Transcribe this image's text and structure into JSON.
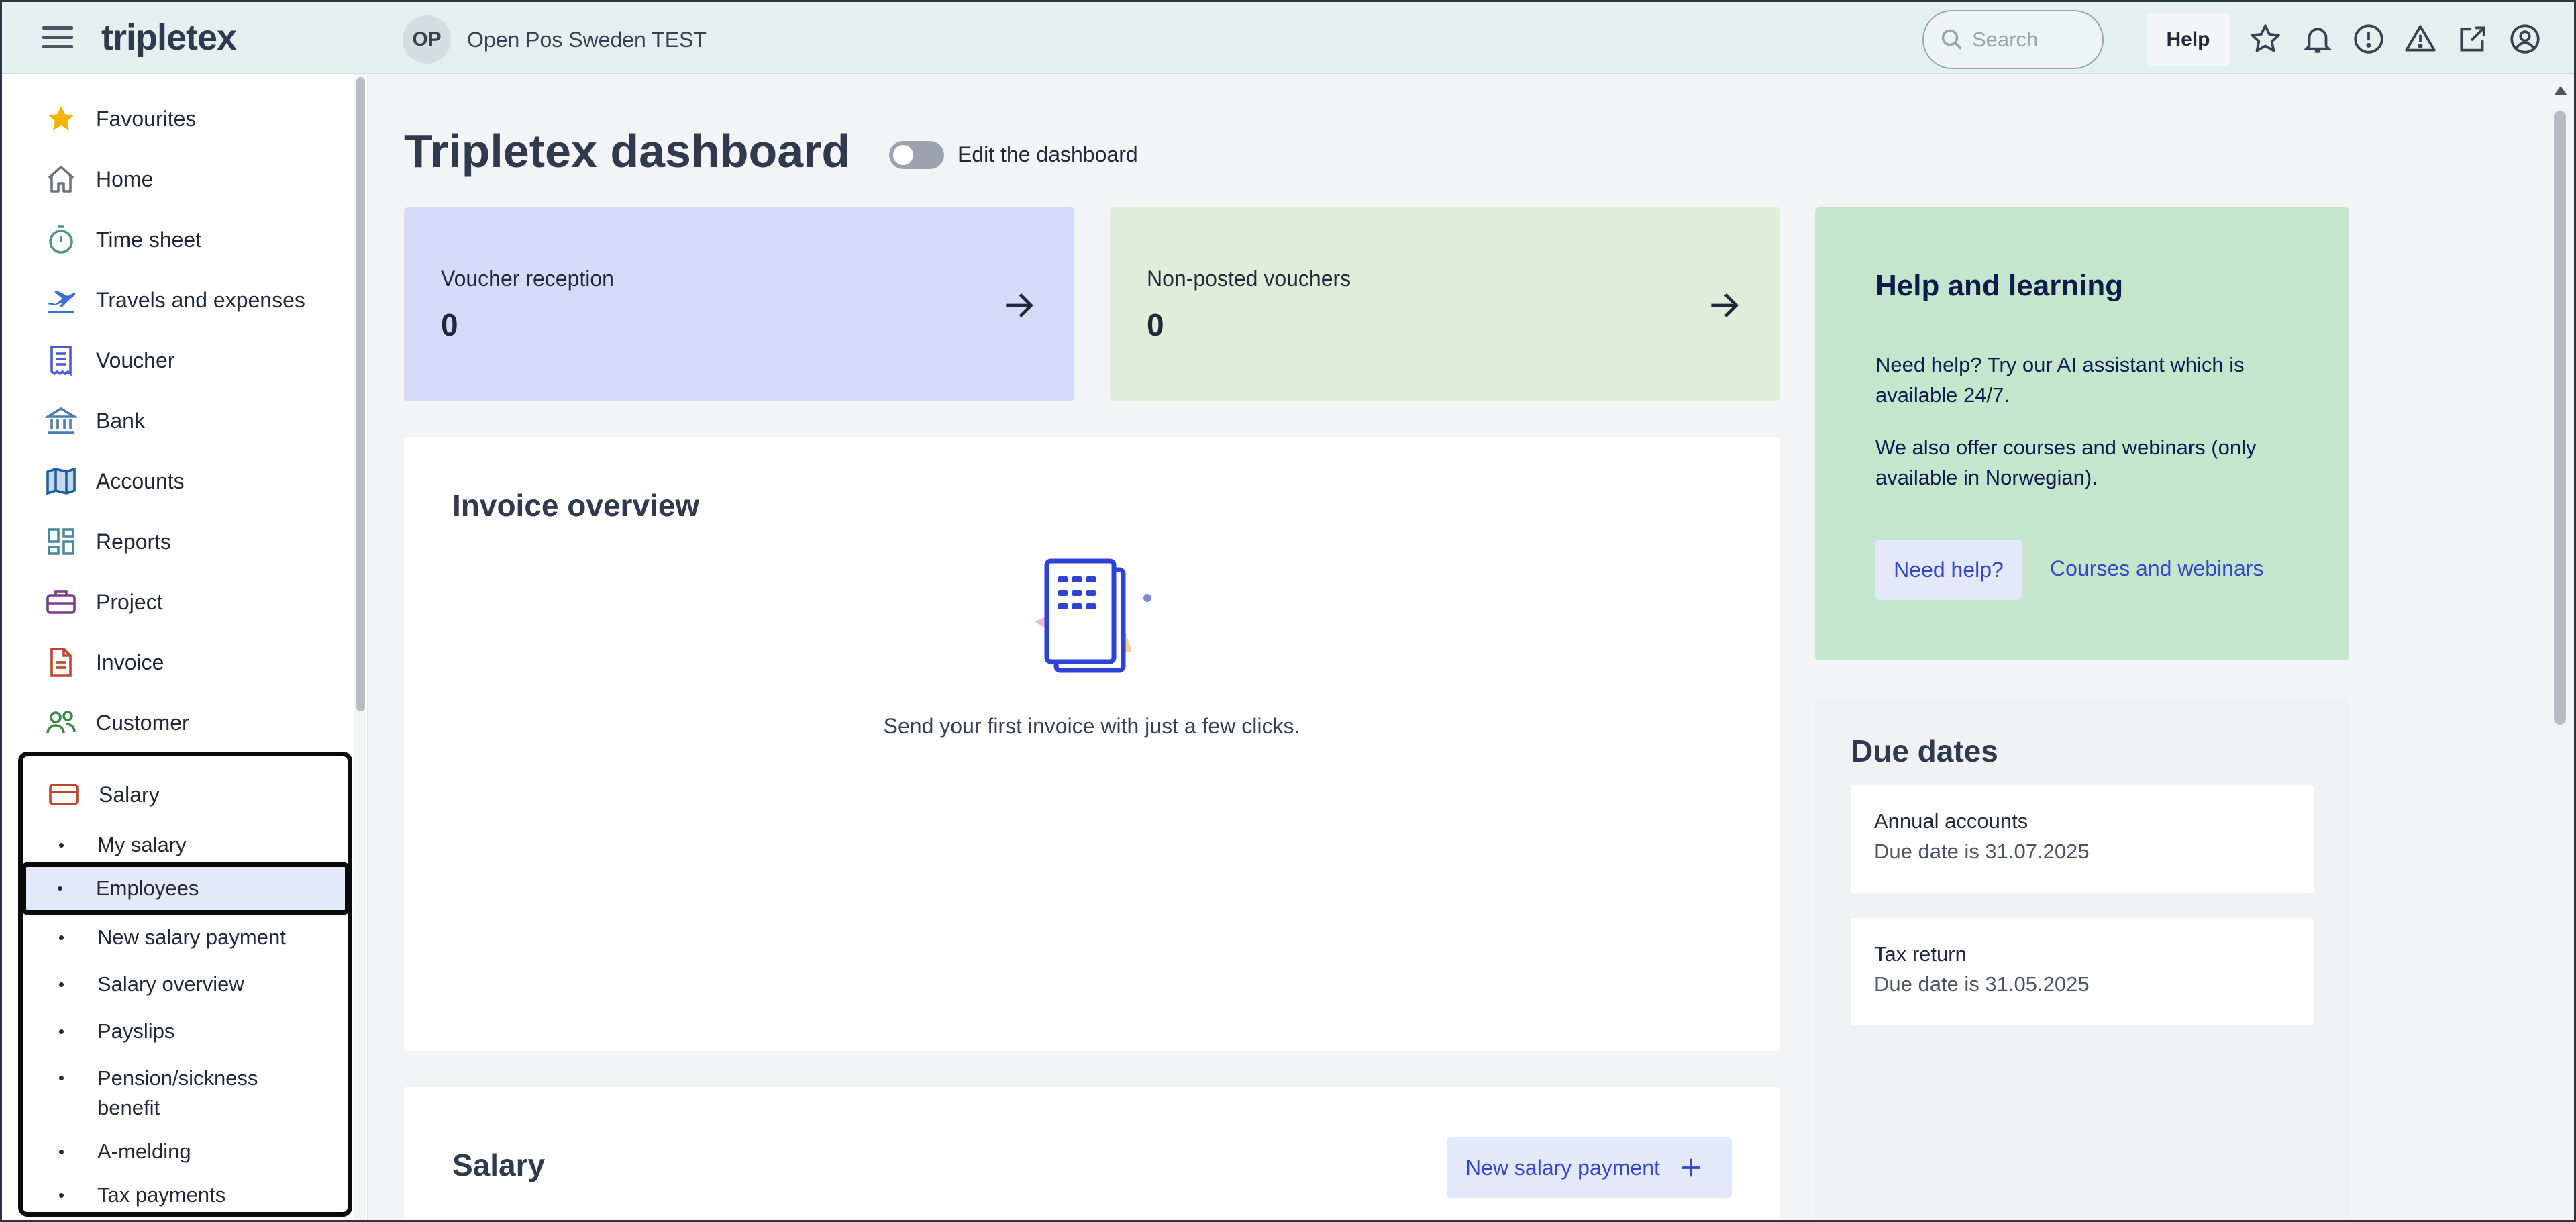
{
  "header": {
    "logo": "tripletex",
    "company_initials": "OP",
    "company_name": "Open Pos Sweden TEST",
    "search_placeholder": "Search",
    "help_label": "Help",
    "icons": [
      "star-icon",
      "bell-icon",
      "alert-circle-icon",
      "warning-triangle-icon",
      "external-link-icon",
      "user-account-icon"
    ]
  },
  "sidebar": {
    "items": [
      {
        "label": "Favourites",
        "icon": "star-icon"
      },
      {
        "label": "Home",
        "icon": "home-icon"
      },
      {
        "label": "Time sheet",
        "icon": "stopwatch-icon"
      },
      {
        "label": "Travels and expenses",
        "icon": "airplane-icon"
      },
      {
        "label": "Voucher",
        "icon": "receipt-icon"
      },
      {
        "label": "Bank",
        "icon": "bank-icon"
      },
      {
        "label": "Accounts",
        "icon": "book-icon"
      },
      {
        "label": "Reports",
        "icon": "dashboard-icon"
      },
      {
        "label": "Project",
        "icon": "briefcase-icon"
      },
      {
        "label": "Invoice",
        "icon": "document-icon"
      },
      {
        "label": "Customer",
        "icon": "people-icon"
      },
      {
        "label": "Salary",
        "icon": "credit-card-icon"
      }
    ],
    "salary_sub_items": [
      "My salary",
      "Employees",
      "New salary payment",
      "Salary overview",
      "Payslips",
      "Pension/sickness benefit",
      "A-melding",
      "Tax payments"
    ],
    "active_sub_item": "Employees"
  },
  "main": {
    "title": "Tripletex dashboard",
    "edit_toggle_label": "Edit the dashboard",
    "voucher_reception": {
      "label": "Voucher reception",
      "value": "0"
    },
    "non_posted_vouchers": {
      "label": "Non-posted vouchers",
      "value": "0"
    },
    "help": {
      "title": "Help and learning",
      "text1": "Need help? Try our AI assistant which is available 24/7.",
      "text2": "We also offer courses and webinars (only available in Norwegian).",
      "need_help_label": "Need help?",
      "courses_label": "Courses and webinars"
    },
    "invoice_overview": {
      "title": "Invoice overview",
      "message": "Send your first invoice with just a few clicks."
    },
    "due_dates": {
      "title": "Due dates",
      "items": [
        {
          "name": "Annual accounts",
          "date": "Due date is 31.07.2025"
        },
        {
          "name": "Tax return",
          "date": "Due date is 31.05.2025"
        }
      ]
    },
    "salary": {
      "title": "Salary",
      "new_payment_label": "New salary payment"
    }
  },
  "colors": {
    "topbar": "#e4f0ef",
    "voucher_card": "#d3dbf8",
    "nonposted_card": "#deeeda",
    "help_card": "#c3e6cd",
    "link": "#3547c8"
  }
}
